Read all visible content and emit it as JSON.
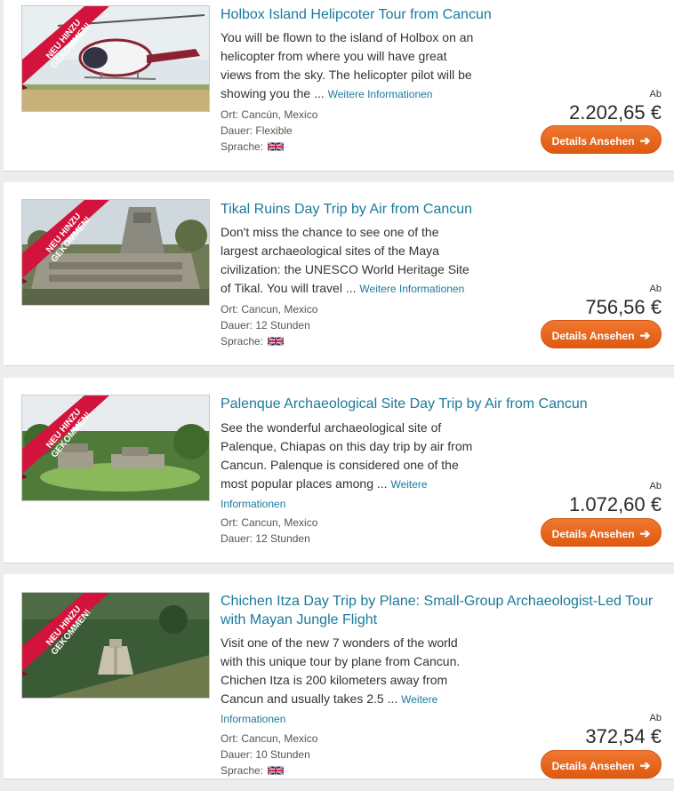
{
  "labels": {
    "ort": "Ort:",
    "dauer": "Dauer:",
    "sprache": "Sprache:",
    "ab": "Ab",
    "more_sep": "..."
  },
  "colors": {
    "accent_link": "#1a7a9c",
    "button": "#e8661c",
    "ribbon": "#d2143c"
  },
  "tours": [
    {
      "badge": "NEU HINZU GEKOMMEN!",
      "title": "Holbox Island Helipcoter Tour from Cancun",
      "description": "You will be flown to the island of Holbox on an helicopter from where you will have great views from the sky. The helicopter pilot will be showing you the",
      "more_link": "Weitere Informationen",
      "location": "Cancún, Mexico",
      "duration": "Flexible",
      "language_icon": "uk-flag-icon",
      "price": "2.202,65 €",
      "button": "Details Ansehen"
    },
    {
      "badge": "NEU HINZU GEKOMMEN!",
      "title": "Tikal Ruins Day Trip by Air from Cancun",
      "description": "Don't miss the chance to see one of the largest archaeological sites of the Maya civilization: the UNESCO World Heritage Site of Tikal. You will travel",
      "more_link": "Weitere Informationen",
      "location": "Cancun, Mexico",
      "duration": "12 Stunden",
      "language_icon": "uk-flag-icon",
      "price": "756,56 €",
      "button": "Details Ansehen"
    },
    {
      "badge": "NEU HINZU GEKOMMEN!",
      "title": "Palenque Archaeological Site Day Trip by Air from Cancun",
      "description": "See the wonderful archaeological site of Palenque, Chiapas on this day trip by air from Cancun. Palenque is considered one of the most popular places among",
      "more_link": "Weitere Informationen",
      "location": "Cancun, Mexico",
      "duration": "12 Stunden",
      "price": "1.072,60 €",
      "button": "Details Ansehen"
    },
    {
      "badge": "NEU HINZU GEKOMMEN!",
      "title": "Chichen Itza Day Trip by Plane: Small-Group Archaeologist-Led Tour with Mayan Jungle Flight",
      "description": "Visit one of the new 7 wonders of the world with this unique tour by plane from Cancun. Chichen Itza is 200 kilometers away from Cancun and usually takes 2.5",
      "more_link": "Weitere Informationen",
      "location": "Cancun, Mexico",
      "duration": "10 Stunden",
      "language_icon": "uk-flag-icon",
      "price": "372,54 €",
      "button": "Details Ansehen"
    }
  ]
}
